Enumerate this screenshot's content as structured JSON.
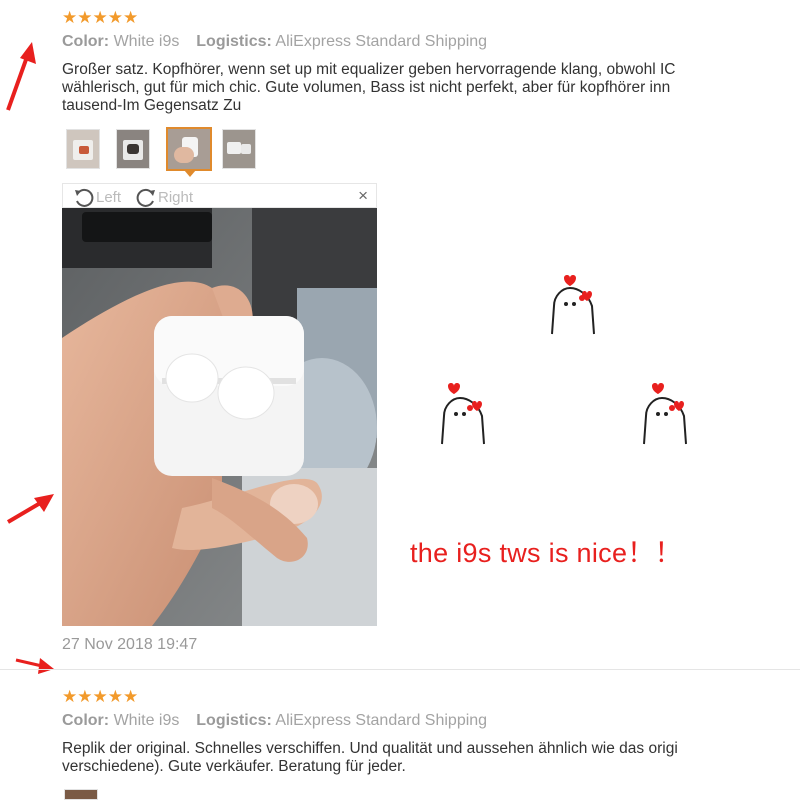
{
  "reviews": [
    {
      "stars": "★★★★★",
      "color_key": "Color:",
      "color_value": "White i9s",
      "logistics_key": "Logistics:",
      "logistics_value": "AliExpress Standard Shipping",
      "text_lines": [
        "Großer satz. Kopfhörer, wenn set up mit equalizer geben hervorragende klang, obwohl IC",
        "wählerisch, gut für mich chic. Gute volumen, Bass ist nicht perfekt, aber für kopfhörer inn",
        "tausend-Im Gegensatz Zu"
      ],
      "viewer": {
        "rotate_left": "Left",
        "rotate_right": "Right",
        "close": "×"
      },
      "date": "27 Nov 2018 19:47"
    },
    {
      "stars": "★★★★★",
      "color_key": "Color:",
      "color_value": "White i9s",
      "logistics_key": "Logistics:",
      "logistics_value": "AliExpress Standard Shipping",
      "text_lines": [
        "Replik der original. Schnelles verschiffen. Und qualität und aussehen ähnlich wie das origi",
        "verschiedene). Gute verkäufer. Beratung für jeder."
      ]
    }
  ],
  "overlay": {
    "caption": "the i9s tws is nice！！",
    "annotation_color": "#e8201e"
  },
  "colors": {
    "star": "#f29a2b",
    "thumb_selected_border": "#e08a2c"
  }
}
